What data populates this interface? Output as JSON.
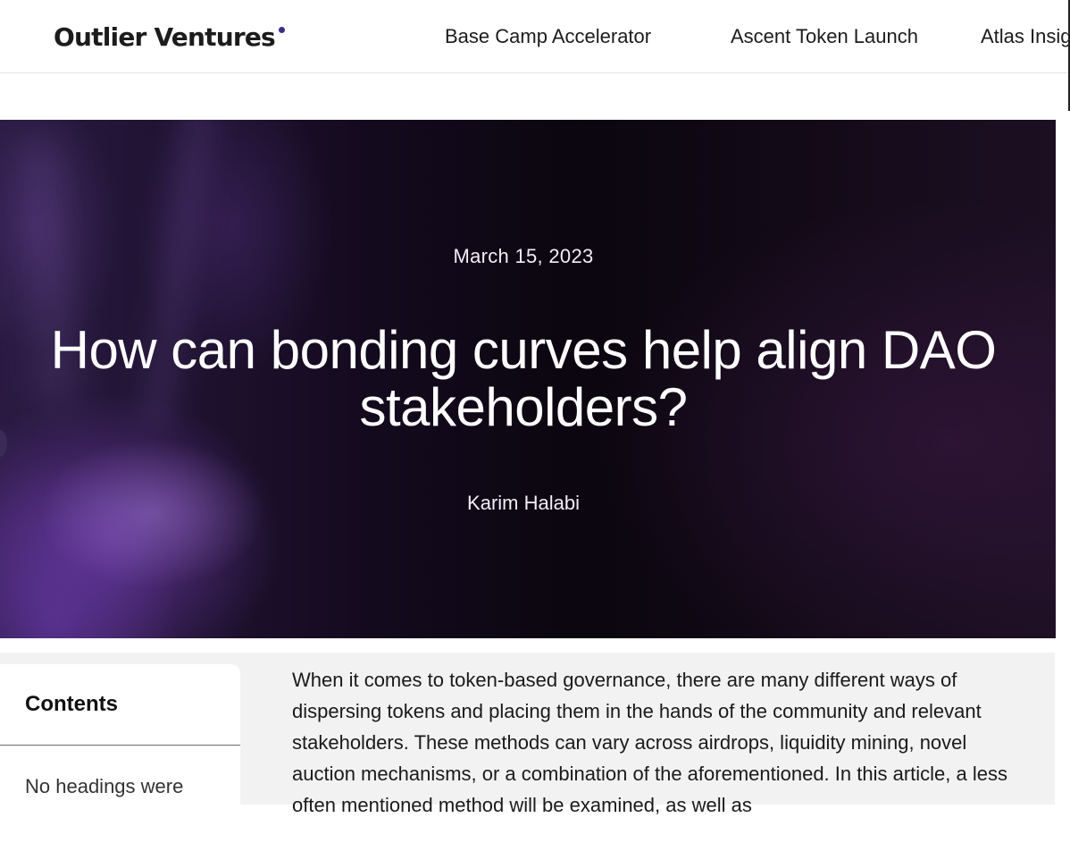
{
  "header": {
    "logo_text": "Outlier Ventures",
    "brand_dot_color": "#3f2a8c",
    "nav": [
      {
        "label": "Base Camp Accelerator"
      },
      {
        "label": "Ascent Token Launch"
      },
      {
        "label": "Atlas Insig"
      }
    ]
  },
  "hero": {
    "date": "March 15, 2023",
    "title": "How can bonding curves help align DAO stakeholders?",
    "author": "Karim Halabi"
  },
  "sidebar": {
    "title": "Contents",
    "empty_message": "No headings were"
  },
  "article": {
    "intro": "When it comes to token-based governance, there are many different ways of dispersing tokens and placing them in the hands of the community and relevant stakeholders. These methods can vary across airdrops, liquidity mining, novel auction mechanisms, or a combination of the aforementioned. In this article, a less often mentioned method will be examined, as well as"
  }
}
